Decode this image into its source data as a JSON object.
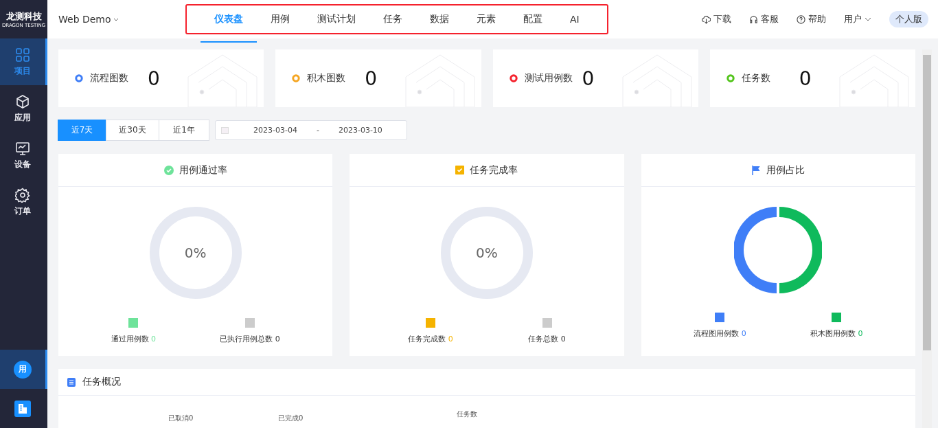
{
  "brand": {
    "name": "龙测科技",
    "tagline": "DRAGON TESTING"
  },
  "project": {
    "name": "Web Demo"
  },
  "nav_tabs": [
    {
      "label": "仪表盘",
      "selected": true
    },
    {
      "label": "用例",
      "selected": false
    },
    {
      "label": "测试计划",
      "selected": false
    },
    {
      "label": "任务",
      "selected": false
    },
    {
      "label": "数据",
      "selected": false
    },
    {
      "label": "元素",
      "selected": false
    },
    {
      "label": "配置",
      "selected": false
    },
    {
      "label": "AI",
      "selected": false
    }
  ],
  "header_actions": [
    {
      "kind": "download",
      "label": "下载"
    },
    {
      "kind": "support",
      "label": "客服"
    },
    {
      "kind": "help",
      "label": "帮助"
    },
    {
      "kind": "user",
      "label": "用户"
    }
  ],
  "edition_badge": "个人版",
  "sidebar": {
    "items": [
      {
        "kind": "grid",
        "label": "项目",
        "selected": true
      },
      {
        "kind": "cube",
        "label": "应用",
        "selected": false
      },
      {
        "kind": "monitor",
        "label": "设备",
        "selected": false
      },
      {
        "kind": "gear",
        "label": "订单",
        "selected": false
      }
    ],
    "bottom": [
      {
        "kind": "avatar",
        "label": "用",
        "selected": true
      },
      {
        "kind": "building",
        "selected": false
      }
    ]
  },
  "stats": [
    {
      "label": "流程图数",
      "value": "0",
      "color": "#3f7ef7"
    },
    {
      "label": "积木图数",
      "value": "0",
      "color": "#f5a623"
    },
    {
      "label": "测试用例数",
      "value": "0",
      "color": "#f5222d"
    },
    {
      "label": "任务数",
      "value": "0",
      "color": "#52c41a"
    }
  ],
  "ranges": [
    {
      "label": "近7天",
      "selected": true
    },
    {
      "label": "近30天",
      "selected": false
    },
    {
      "label": "近1年",
      "selected": false
    }
  ],
  "date_range": {
    "start": "2023-03-04",
    "separator": "-",
    "end": "2023-03-10"
  },
  "panels": [
    {
      "title": "用例通过率",
      "kind": "check",
      "ring": {
        "kind": "empty",
        "text": "0%"
      },
      "legend": [
        {
          "label": "通过用例数",
          "value": "0",
          "color": "#6ee39a"
        },
        {
          "label": "已执行用例总数",
          "value": "0",
          "color": "#cccccc"
        }
      ]
    },
    {
      "title": "任务完成率",
      "kind": "checkbox",
      "ring": {
        "kind": "empty",
        "text": "0%"
      },
      "legend": [
        {
          "label": "任务完成数",
          "value": "0",
          "color": "#f5b300"
        },
        {
          "label": "任务总数",
          "value": "0",
          "color": "#cccccc"
        }
      ]
    },
    {
      "title": "用例占比",
      "kind": "flag",
      "ring": {
        "kind": "split"
      },
      "legend": [
        {
          "label": "流程图用例数",
          "value": "0",
          "color": "#3f7ef7"
        },
        {
          "label": "积木图用例数",
          "value": "0",
          "color": "#0fba5c"
        }
      ]
    }
  ],
  "overview": {
    "title": "任务概况",
    "labels": [
      "已取消0",
      "已完成0",
      "任务数"
    ]
  }
}
